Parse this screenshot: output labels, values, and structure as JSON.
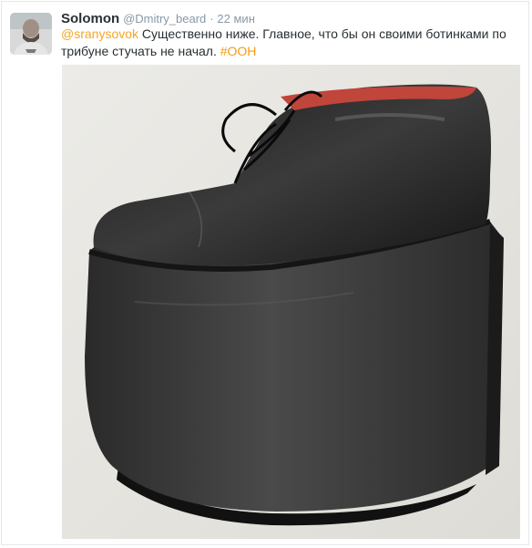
{
  "tweet": {
    "author_name": "Solomon",
    "author_handle": "@Dmitry_beard",
    "separator": "·",
    "time": "22 мин",
    "mention": "@sranysovok",
    "text": " Существенно ниже. Главное, что бы он своими ботинками по трибуне стучать не начал. ",
    "hashtag": "#ООН"
  },
  "colors": {
    "link": "#f5a623",
    "hashtag": "#f39c12",
    "text": "#292f33",
    "muted": "#8899a6"
  }
}
